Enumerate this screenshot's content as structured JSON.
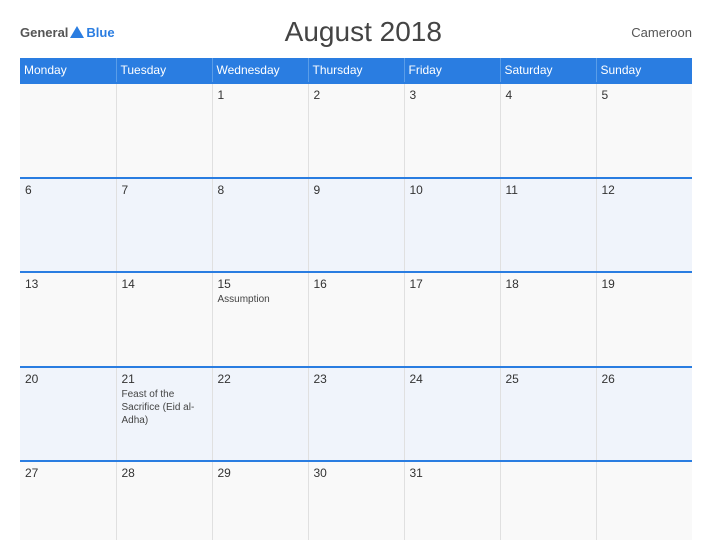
{
  "header": {
    "logo": {
      "general": "General",
      "blue": "Blue",
      "triangle": true
    },
    "title": "August 2018",
    "country": "Cameroon"
  },
  "calendar": {
    "columns": [
      "Monday",
      "Tuesday",
      "Wednesday",
      "Thursday",
      "Friday",
      "Saturday",
      "Sunday"
    ],
    "rows": [
      [
        {
          "day": "",
          "event": ""
        },
        {
          "day": "",
          "event": ""
        },
        {
          "day": "1",
          "event": ""
        },
        {
          "day": "2",
          "event": ""
        },
        {
          "day": "3",
          "event": ""
        },
        {
          "day": "4",
          "event": ""
        },
        {
          "day": "5",
          "event": ""
        }
      ],
      [
        {
          "day": "6",
          "event": ""
        },
        {
          "day": "7",
          "event": ""
        },
        {
          "day": "8",
          "event": ""
        },
        {
          "day": "9",
          "event": ""
        },
        {
          "day": "10",
          "event": ""
        },
        {
          "day": "11",
          "event": ""
        },
        {
          "day": "12",
          "event": ""
        }
      ],
      [
        {
          "day": "13",
          "event": ""
        },
        {
          "day": "14",
          "event": ""
        },
        {
          "day": "15",
          "event": "Assumption"
        },
        {
          "day": "16",
          "event": ""
        },
        {
          "day": "17",
          "event": ""
        },
        {
          "day": "18",
          "event": ""
        },
        {
          "day": "19",
          "event": ""
        }
      ],
      [
        {
          "day": "20",
          "event": ""
        },
        {
          "day": "21",
          "event": "Feast of the Sacrifice (Eid al-Adha)"
        },
        {
          "day": "22",
          "event": ""
        },
        {
          "day": "23",
          "event": ""
        },
        {
          "day": "24",
          "event": ""
        },
        {
          "day": "25",
          "event": ""
        },
        {
          "day": "26",
          "event": ""
        }
      ],
      [
        {
          "day": "27",
          "event": ""
        },
        {
          "day": "28",
          "event": ""
        },
        {
          "day": "29",
          "event": ""
        },
        {
          "day": "30",
          "event": ""
        },
        {
          "day": "31",
          "event": ""
        },
        {
          "day": "",
          "event": ""
        },
        {
          "day": "",
          "event": ""
        }
      ]
    ]
  }
}
